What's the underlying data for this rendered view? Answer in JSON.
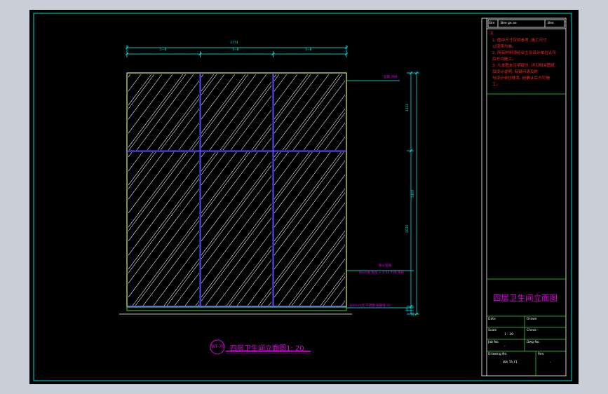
{
  "dimensions": {
    "total_width": "3774",
    "segment_widths": [
      "1~8",
      "1~8",
      "1~8"
    ],
    "upper_height": "1110",
    "total_height": "3400",
    "lower_height": "2020",
    "base_height": "80",
    "bottom_height": "20"
  },
  "callouts": {
    "ceiling": "石膏 顶线",
    "glass_partition": "防火玻璃",
    "glass_spec": "8mm厚 钢化 + 1.52 PVB 夹胶",
    "skirting": "100mm高 不锈钢 踢脚线 30"
  },
  "caption": {
    "label": "WT-70",
    "title": "四层卫生间立面图1: 20"
  },
  "title_block": {
    "header": [
      "Sim",
      "Bee   ge ae",
      "Bee"
    ],
    "notes_heading": "注",
    "notes": [
      "1. 图中尺寸仅供参考, 施工尺寸",
      "   以现场为准。",
      "2. 所有材料须经业主及设计单位认可",
      "   后方可施工。",
      "3. 凡本图未注明部分, 详见相关图纸",
      "   及设计说明, 有疑问请及时",
      "   与设计单位联系, 经确认后方可施",
      "   工。"
    ],
    "drawing_title": "四层卫生间立面图",
    "row_labels": [
      "Date",
      "Drawn",
      "Scale",
      "Check",
      "Job No.",
      "Dwg No."
    ],
    "scale_value": "1 : 20",
    "job_value": "-",
    "drawing_no_label": "Drawing No.",
    "drawing_no_value": "WA TA-F1",
    "rev_label": "Rev.",
    "rev_value": "-"
  },
  "colors": {
    "paper": "#000000",
    "frame": "#00d8d8",
    "panel_outline": "#e8e87a",
    "mullion": "#5a4cff",
    "hatch": "#ffffff",
    "dimension": "#00ffff",
    "annotation": "#e000e0",
    "notes": "#ff2a2a"
  }
}
